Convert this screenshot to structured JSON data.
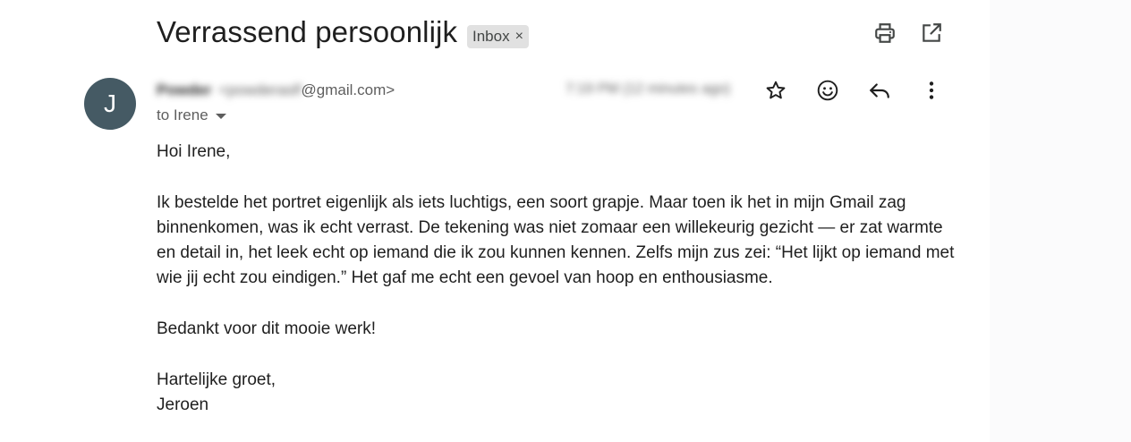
{
  "email": {
    "subject": "Verrassend persoonlijk",
    "label": "Inbox",
    "label_remove": "×",
    "sender": {
      "avatar_letter": "J",
      "name": "Powder",
      "email_prefix": "<powderaslf",
      "email_domain": "@gmail.com>",
      "timestamp": "7:19 PM (12 minutes ago)"
    },
    "recipient": "to Irene",
    "body": {
      "greeting": "Hoi Irene,",
      "paragraph": "Ik bestelde het portret eigenlijk als iets luchtigs, een soort grapje. Maar toen ik het in mijn Gmail zag binnenkomen, was ik echt verrast. De tekening was niet zomaar een willekeurig gezicht — er zat warmte en detail in, het leek echt op iemand die ik zou kunnen kennen. Zelfs mijn zus zei: “Het lijkt op iemand met wie jij echt zou eindigen.” Het gaf me echt een gevoel van hoop en enthousiasme.",
      "thanks": "Bedankt voor dit mooie werk!",
      "closing": "Hartelijke groet,",
      "signature": "Jeroen"
    }
  },
  "icons": {
    "print": "print-icon",
    "open_new_window": "open-in-new-window-icon",
    "star": "star-icon",
    "emoji": "emoji-icon",
    "reply": "reply-icon",
    "more": "more-vert-icon"
  },
  "colors": {
    "avatar_bg": "#455a64",
    "chip_bg": "#e1e1e1",
    "text_primary": "#1f1f1f",
    "text_secondary": "#5e5e5e"
  }
}
